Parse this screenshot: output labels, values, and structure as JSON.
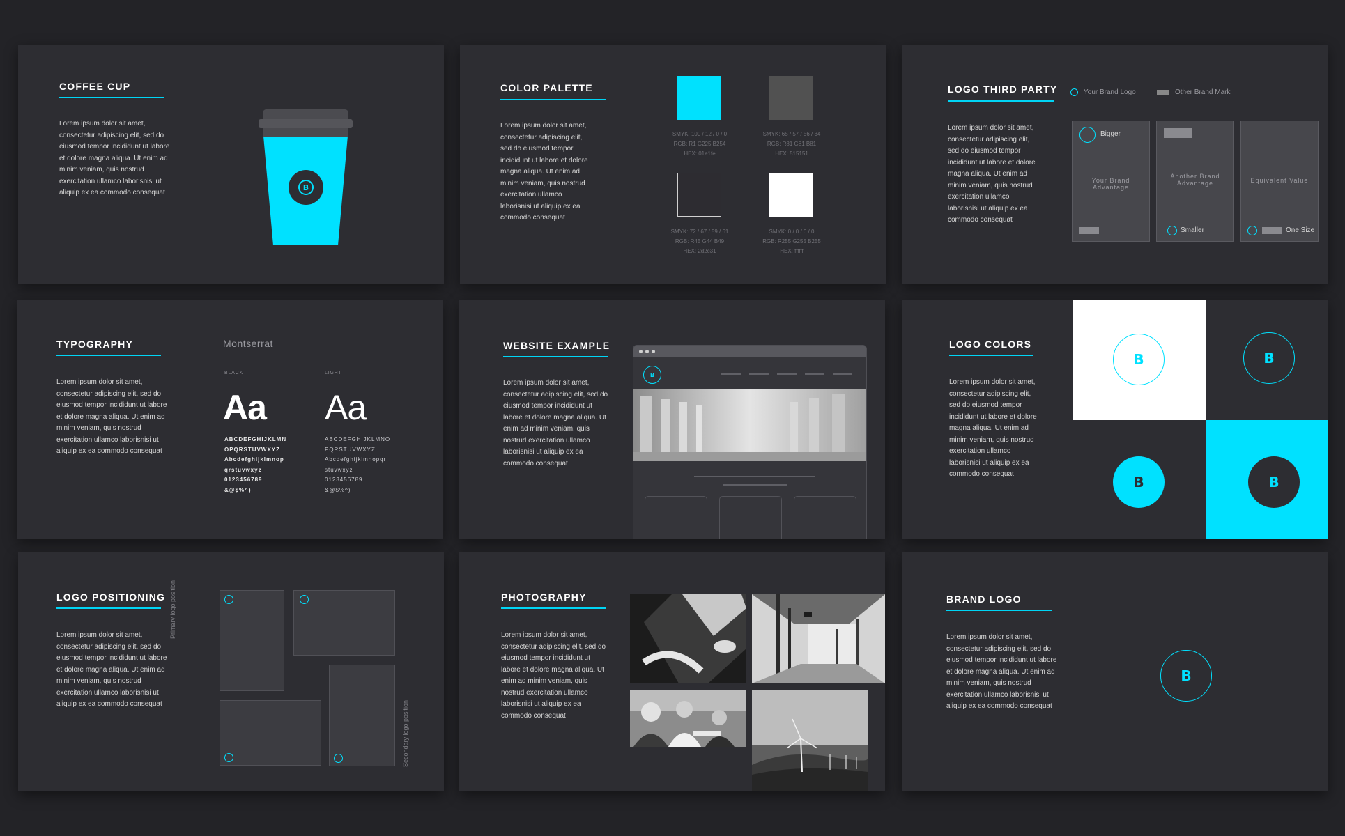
{
  "body_text": "Lorem ipsum dolor sit amet, consectetur adipiscing elit, sed do eiusmod tempor incididunt ut labore et dolore magna aliqua. Ut enim ad minim veniam, quis nostrud exercitation ullamco laborisnisi ut aliquip ex ea commodo consequat",
  "colors": {
    "accent": "#00e1ff",
    "slide_bg": "#2d2d32",
    "page_bg": "#232327"
  },
  "brand_mark_letter": "B",
  "coffee": {
    "title": "COFFEE CUP"
  },
  "palette": {
    "title": "COLOR PALETTE",
    "swatches": [
      {
        "color": "#00e1fe",
        "smyk": "SMYK: 100 / 12 / 0 / 0",
        "rgb": "RGB: R1 G225 B254",
        "hex": "HEX: 01e1fe"
      },
      {
        "color": "#515151",
        "smyk": "SMYK: 65 / 57 / 56 / 34",
        "rgb": "RGB: R81 G81 B81",
        "hex": "HEX: 515151"
      },
      {
        "color": "#2d2c31",
        "smyk": "SMYK: 72 / 67 / 59 / 61",
        "rgb": "RGB: R45 G44 B49",
        "hex": "HEX: 2d2c31"
      },
      {
        "color": "#ffffff",
        "smyk": "SMYK: 0 / 0 / 0 / 0",
        "rgb": "RGB: R255 G255 B255",
        "hex": "HEX: ffffff"
      }
    ]
  },
  "third_party": {
    "title": "LOGO THIRD PARTY",
    "legend_brand": "Your Brand Logo",
    "legend_other": "Other Brand Mark",
    "cards": [
      {
        "top": "Bigger",
        "middle": "Your Brand Advantage",
        "bottom": ""
      },
      {
        "top": "",
        "middle": "Another Brand Advantage",
        "bottom": "Smaller"
      },
      {
        "top": "",
        "middle": "Equivalent Value",
        "bottom": "One Size"
      }
    ]
  },
  "typography": {
    "title": "TYPOGRAPHY",
    "font_name": "Montserrat",
    "black_label": "BLACK",
    "light_label": "LIGHT",
    "sample": "Aa",
    "glyphs_black": [
      "ABCDEFGHIJKLMN",
      "OPQRSTUVWXYZ",
      "Abcdefghijklmnop",
      "qrstuvwxyz",
      "0123456789",
      "&@$%^)"
    ],
    "glyphs_light": [
      "ABCDEFGHIJKLMNO",
      "PQRSTUVWXYZ",
      "Abcdefghijklmnopqr",
      "stuvwxyz",
      "0123456789",
      "&@$%^)"
    ]
  },
  "website": {
    "title": "WEBSITE EXAMPLE"
  },
  "logo_colors": {
    "title": "LOGO COLORS"
  },
  "positioning": {
    "title": "LOGO POSITIONING",
    "primary_label": "Primary logo position",
    "secondary_label": "Secondary logo position"
  },
  "photography": {
    "title": "PHOTOGRAPHY"
  },
  "brand_logo": {
    "title": "BRAND LOGO"
  }
}
